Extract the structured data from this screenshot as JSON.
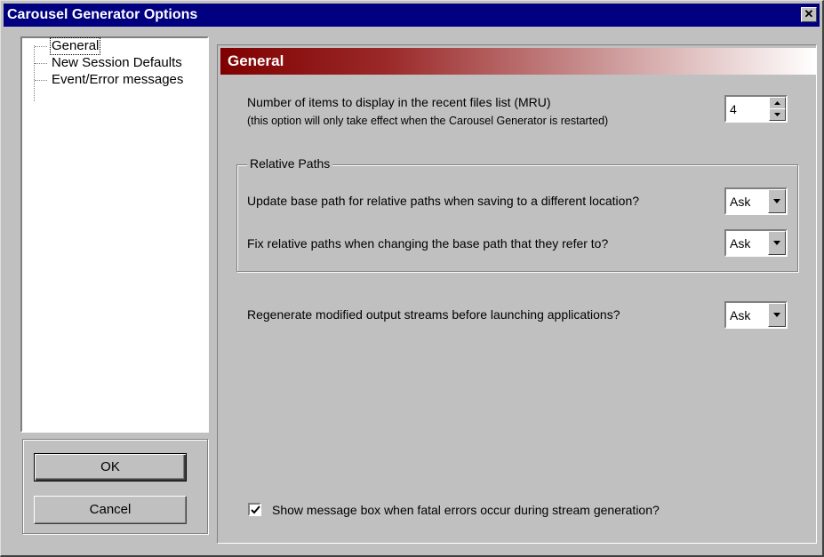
{
  "window": {
    "title": "Carousel Generator Options",
    "close_glyph": "✕"
  },
  "tree": {
    "items": [
      {
        "label": "General",
        "selected": true
      },
      {
        "label": "New Session Defaults",
        "selected": false
      },
      {
        "label": "Event/Error messages",
        "selected": false
      }
    ]
  },
  "buttons": {
    "ok_label": "OK",
    "cancel_label": "Cancel"
  },
  "panel": {
    "title": "General",
    "mru_label": "Number of items to display in the recent files list (MRU)",
    "mru_note": "(this option will only take effect when the Carousel Generator is restarted)",
    "mru_value": "4",
    "relative_paths": {
      "group_label": "Relative Paths",
      "update_base_label": "Update base path for relative paths when saving to a different location?",
      "update_base_value": "Ask",
      "fix_relative_label": "Fix relative paths when changing the base path that they refer to?",
      "fix_relative_value": "Ask"
    },
    "regenerate_label": "Regenerate modified output streams before launching applications?",
    "regenerate_value": "Ask",
    "fatal_errors_label": "Show message box when fatal errors occur during stream generation?",
    "fatal_errors_checked": true
  },
  "colors": {
    "title_bar": "#000080",
    "banner_start": "#800000",
    "dialog_face": "#c0c0c0"
  }
}
